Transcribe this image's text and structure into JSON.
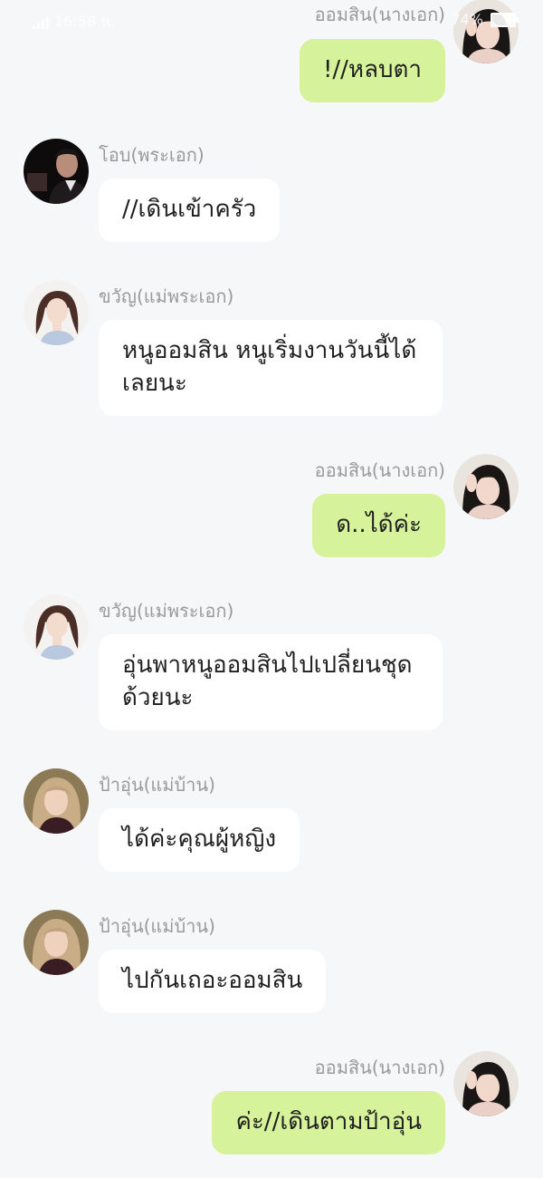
{
  "status_bar": {
    "time": "16:58 น.",
    "battery": "74%"
  },
  "messages": [
    {
      "sender": "ออมสิน(นางเอก)",
      "text": "!//หลบตา",
      "side": "right",
      "avatar_icon": "omsin-avatar"
    },
    {
      "sender": "โอบ(พระเอก)",
      "text": "//เดินเข้าครัว",
      "side": "left",
      "avatar_icon": "obb-avatar"
    },
    {
      "sender": "ขวัญ(แม่พระเอก)",
      "text": "หนูออมสิน หนูเริ่มงานวันนี้ได้เลยนะ",
      "side": "left",
      "avatar_icon": "kwan-avatar"
    },
    {
      "sender": "ออมสิน(นางเอก)",
      "text": "ด..ได้ค่ะ",
      "side": "right",
      "avatar_icon": "omsin-avatar"
    },
    {
      "sender": "ขวัญ(แม่พระเอก)",
      "text": "อุ่นพาหนูออมสินไปเปลี่ยนชุดด้วยนะ",
      "side": "left",
      "avatar_icon": "kwan-avatar"
    },
    {
      "sender": "ป้าอุ่น(แม่บ้าน)",
      "text": "ได้ค่ะคุณผู้หญิง",
      "side": "left",
      "avatar_icon": "aun-avatar"
    },
    {
      "sender": "ป้าอุ่น(แม่บ้าน)",
      "text": "ไปกันเถอะออมสิน",
      "side": "left",
      "avatar_icon": "aun-avatar"
    },
    {
      "sender": "ออมสิน(นางเอก)",
      "text": "ค่ะ//เดินตามป้าอุ่น",
      "side": "right",
      "avatar_icon": "omsin-avatar"
    }
  ],
  "colors": {
    "background": "#f6f7f9",
    "incoming_bubble": "#ffffff",
    "outgoing_bubble": "#d6f39b",
    "sender_name": "#9a9a9a"
  }
}
